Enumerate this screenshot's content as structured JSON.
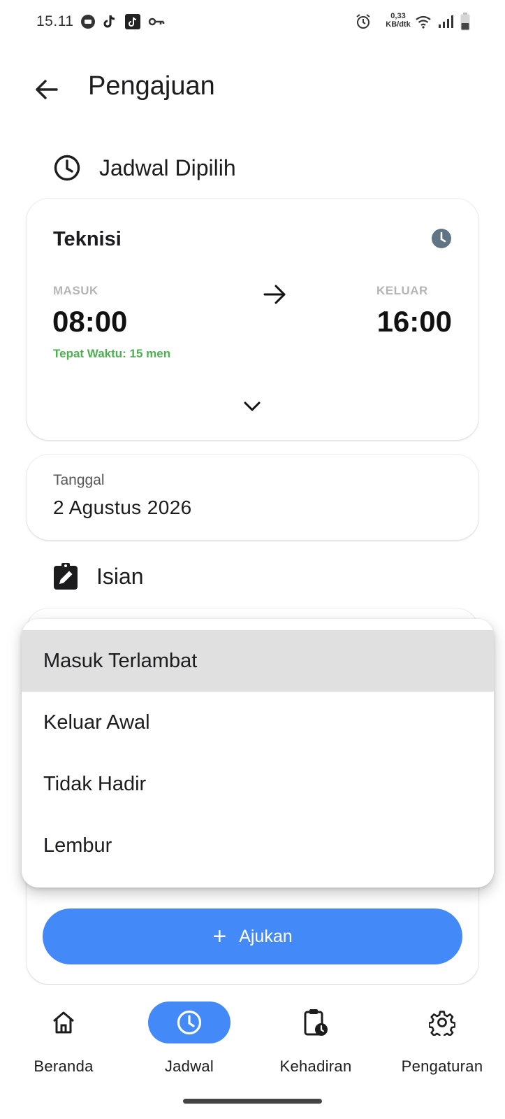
{
  "status_bar": {
    "time": "15.11",
    "net_speed_value": "0,33",
    "net_speed_unit": "KB/dtk"
  },
  "header": {
    "title": "Pengajuan"
  },
  "schedule_section": {
    "title": "Jadwal Dipilih"
  },
  "shift_card": {
    "name": "Teknisi",
    "in_label": "MASUK",
    "in_time": "08:00",
    "tolerance": "Tepat Waktu: 15 men",
    "out_label": "KELUAR",
    "out_time": "16:00"
  },
  "date_field": {
    "label": "Tanggal",
    "value": "2 Agustus 2026"
  },
  "form_section": {
    "title": "Isian"
  },
  "dropdown": {
    "options": [
      {
        "label": "Masuk Terlambat",
        "selected": true
      },
      {
        "label": "Keluar Awal",
        "selected": false
      },
      {
        "label": "Tidak Hadir",
        "selected": false
      },
      {
        "label": "Lembur",
        "selected": false
      }
    ]
  },
  "submit": {
    "label": "Ajukan"
  },
  "bottom_nav": {
    "items": [
      {
        "label": "Beranda",
        "icon": "home-icon",
        "active": false
      },
      {
        "label": "Jadwal",
        "icon": "clock-icon",
        "active": true
      },
      {
        "label": "Kehadiran",
        "icon": "clipboard-clock-icon",
        "active": false
      },
      {
        "label": "Pengaturan",
        "icon": "gear-icon",
        "active": false
      }
    ]
  },
  "colors": {
    "primary": "#4389f8",
    "success": "#4caf50",
    "muted_label": "#b5b5b5",
    "selected_row": "#e0e0e0"
  }
}
